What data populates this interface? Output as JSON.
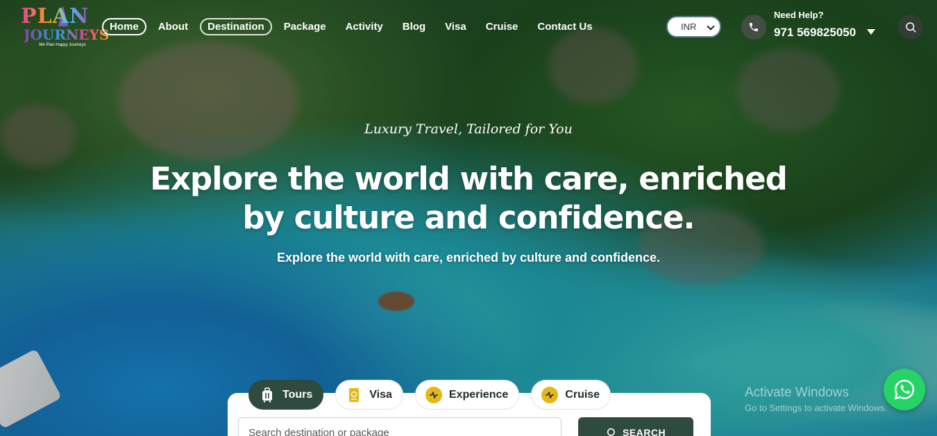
{
  "brand": {
    "logo_line1": "PLAN",
    "logo_line2": "JOURNEYS",
    "logo_tagline": "We Plan Happy Journeys"
  },
  "nav": {
    "items": [
      {
        "label": "Home"
      },
      {
        "label": "About"
      },
      {
        "label": "Destination"
      },
      {
        "label": "Package"
      },
      {
        "label": "Activity"
      },
      {
        "label": "Blog"
      },
      {
        "label": "Visa"
      },
      {
        "label": "Cruise"
      },
      {
        "label": "Contact Us"
      }
    ]
  },
  "header": {
    "currency": "INR",
    "need_help": "Need Help?",
    "phone": "971 569825050"
  },
  "hero": {
    "tagline": "Luxury Travel, Tailored for You",
    "headline_line1": "Explore the world with care, enriched",
    "headline_line2": "by culture and confidence.",
    "subline": "Explore the world with care, enriched by culture and confidence."
  },
  "search": {
    "tabs": [
      {
        "label": "Tours",
        "icon": "luggage-icon"
      },
      {
        "label": "Visa",
        "icon": "passport-icon"
      },
      {
        "label": "Experience",
        "icon": "experience-icon"
      },
      {
        "label": "Cruise",
        "icon": "cruise-icon"
      }
    ],
    "placeholder": "Search destination or package",
    "button_label": "SEARCH"
  },
  "overlay": {
    "activate_title": "Activate Windows",
    "activate_sub": "Go to Settings to activate Windows."
  },
  "colors": {
    "accent": "#2f4a3f",
    "tab_icon": "#e5b81a",
    "whatsapp": "#25d366"
  }
}
